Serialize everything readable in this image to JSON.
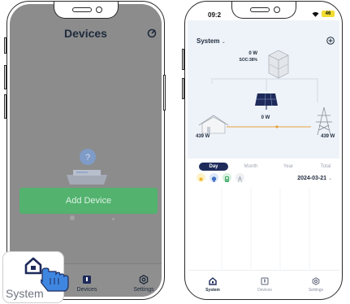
{
  "left_screen": {
    "title": "Devices",
    "add_device_label": "Add Device",
    "tabs": [
      {
        "label": "System",
        "icon": "house-icon"
      },
      {
        "label": "Devices",
        "icon": "devices-icon"
      },
      {
        "label": "Settings",
        "icon": "settings-icon"
      }
    ],
    "callout_label": "System"
  },
  "right_screen": {
    "status_time": "09:2",
    "battery_level": "46",
    "system_selector": "System",
    "inverter_power": "0 W",
    "inverter_soc": "SOC:38%",
    "pv_power": "0 W",
    "home_power": "439 W",
    "grid_power": "439 W",
    "periods": [
      "Day",
      "Month",
      "Year",
      "Total"
    ],
    "active_period": "Day",
    "date": "2024-03-21",
    "tabs": [
      {
        "label": "System"
      },
      {
        "label": "Devices"
      },
      {
        "label": "Settings"
      }
    ]
  },
  "colors": {
    "accent_navy": "#1e2a5a",
    "add_button_green": "#52b26e",
    "flow_orange": "#e8a23c",
    "battery_yellow": "#f2dc30",
    "overlay_gray": "#8c8c8c"
  }
}
